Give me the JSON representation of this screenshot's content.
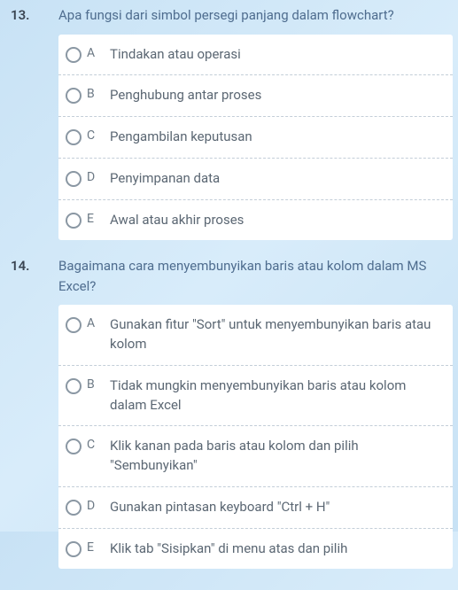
{
  "questions": [
    {
      "number": "13.",
      "text": "Apa fungsi dari simbol persegi panjang dalam flowchart?",
      "options": [
        {
          "letter": "A",
          "text": "Tindakan atau operasi"
        },
        {
          "letter": "B",
          "text": "Penghubung antar proses"
        },
        {
          "letter": "C",
          "text": "Pengambilan keputusan"
        },
        {
          "letter": "D",
          "text": "Penyimpanan data"
        },
        {
          "letter": "E",
          "text": "Awal atau akhir proses"
        }
      ]
    },
    {
      "number": "14.",
      "text": "Bagaimana cara menyembunyikan baris atau kolom dalam MS Excel?",
      "options": [
        {
          "letter": "A",
          "text": "Gunakan fitur \"Sort\" untuk menyembunyikan baris atau kolom"
        },
        {
          "letter": "B",
          "text": "Tidak mungkin menyembunyikan baris atau kolom dalam Excel"
        },
        {
          "letter": "C",
          "text": "Klik kanan pada baris atau kolom dan pilih \"Sembunyikan\""
        },
        {
          "letter": "D",
          "text": "Gunakan pintasan keyboard \"Ctrl + H\""
        },
        {
          "letter": "E",
          "text": "Klik tab \"Sisipkan\" di menu atas dan pilih"
        }
      ]
    }
  ]
}
